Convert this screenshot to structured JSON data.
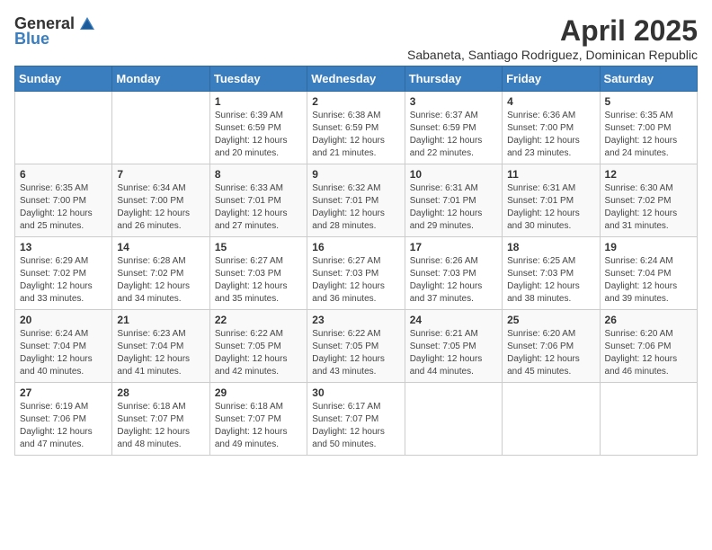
{
  "logo": {
    "general": "General",
    "blue": "Blue"
  },
  "title": "April 2025",
  "subtitle": "Sabaneta, Santiago Rodriguez, Dominican Republic",
  "days_header": [
    "Sunday",
    "Monday",
    "Tuesday",
    "Wednesday",
    "Thursday",
    "Friday",
    "Saturday"
  ],
  "weeks": [
    [
      {
        "day": null,
        "info": null
      },
      {
        "day": null,
        "info": null
      },
      {
        "day": "1",
        "sunrise": "Sunrise: 6:39 AM",
        "sunset": "Sunset: 6:59 PM",
        "daylight": "Daylight: 12 hours and 20 minutes."
      },
      {
        "day": "2",
        "sunrise": "Sunrise: 6:38 AM",
        "sunset": "Sunset: 6:59 PM",
        "daylight": "Daylight: 12 hours and 21 minutes."
      },
      {
        "day": "3",
        "sunrise": "Sunrise: 6:37 AM",
        "sunset": "Sunset: 6:59 PM",
        "daylight": "Daylight: 12 hours and 22 minutes."
      },
      {
        "day": "4",
        "sunrise": "Sunrise: 6:36 AM",
        "sunset": "Sunset: 7:00 PM",
        "daylight": "Daylight: 12 hours and 23 minutes."
      },
      {
        "day": "5",
        "sunrise": "Sunrise: 6:35 AM",
        "sunset": "Sunset: 7:00 PM",
        "daylight": "Daylight: 12 hours and 24 minutes."
      }
    ],
    [
      {
        "day": "6",
        "sunrise": "Sunrise: 6:35 AM",
        "sunset": "Sunset: 7:00 PM",
        "daylight": "Daylight: 12 hours and 25 minutes."
      },
      {
        "day": "7",
        "sunrise": "Sunrise: 6:34 AM",
        "sunset": "Sunset: 7:00 PM",
        "daylight": "Daylight: 12 hours and 26 minutes."
      },
      {
        "day": "8",
        "sunrise": "Sunrise: 6:33 AM",
        "sunset": "Sunset: 7:01 PM",
        "daylight": "Daylight: 12 hours and 27 minutes."
      },
      {
        "day": "9",
        "sunrise": "Sunrise: 6:32 AM",
        "sunset": "Sunset: 7:01 PM",
        "daylight": "Daylight: 12 hours and 28 minutes."
      },
      {
        "day": "10",
        "sunrise": "Sunrise: 6:31 AM",
        "sunset": "Sunset: 7:01 PM",
        "daylight": "Daylight: 12 hours and 29 minutes."
      },
      {
        "day": "11",
        "sunrise": "Sunrise: 6:31 AM",
        "sunset": "Sunset: 7:01 PM",
        "daylight": "Daylight: 12 hours and 30 minutes."
      },
      {
        "day": "12",
        "sunrise": "Sunrise: 6:30 AM",
        "sunset": "Sunset: 7:02 PM",
        "daylight": "Daylight: 12 hours and 31 minutes."
      }
    ],
    [
      {
        "day": "13",
        "sunrise": "Sunrise: 6:29 AM",
        "sunset": "Sunset: 7:02 PM",
        "daylight": "Daylight: 12 hours and 33 minutes."
      },
      {
        "day": "14",
        "sunrise": "Sunrise: 6:28 AM",
        "sunset": "Sunset: 7:02 PM",
        "daylight": "Daylight: 12 hours and 34 minutes."
      },
      {
        "day": "15",
        "sunrise": "Sunrise: 6:27 AM",
        "sunset": "Sunset: 7:03 PM",
        "daylight": "Daylight: 12 hours and 35 minutes."
      },
      {
        "day": "16",
        "sunrise": "Sunrise: 6:27 AM",
        "sunset": "Sunset: 7:03 PM",
        "daylight": "Daylight: 12 hours and 36 minutes."
      },
      {
        "day": "17",
        "sunrise": "Sunrise: 6:26 AM",
        "sunset": "Sunset: 7:03 PM",
        "daylight": "Daylight: 12 hours and 37 minutes."
      },
      {
        "day": "18",
        "sunrise": "Sunrise: 6:25 AM",
        "sunset": "Sunset: 7:03 PM",
        "daylight": "Daylight: 12 hours and 38 minutes."
      },
      {
        "day": "19",
        "sunrise": "Sunrise: 6:24 AM",
        "sunset": "Sunset: 7:04 PM",
        "daylight": "Daylight: 12 hours and 39 minutes."
      }
    ],
    [
      {
        "day": "20",
        "sunrise": "Sunrise: 6:24 AM",
        "sunset": "Sunset: 7:04 PM",
        "daylight": "Daylight: 12 hours and 40 minutes."
      },
      {
        "day": "21",
        "sunrise": "Sunrise: 6:23 AM",
        "sunset": "Sunset: 7:04 PM",
        "daylight": "Daylight: 12 hours and 41 minutes."
      },
      {
        "day": "22",
        "sunrise": "Sunrise: 6:22 AM",
        "sunset": "Sunset: 7:05 PM",
        "daylight": "Daylight: 12 hours and 42 minutes."
      },
      {
        "day": "23",
        "sunrise": "Sunrise: 6:22 AM",
        "sunset": "Sunset: 7:05 PM",
        "daylight": "Daylight: 12 hours and 43 minutes."
      },
      {
        "day": "24",
        "sunrise": "Sunrise: 6:21 AM",
        "sunset": "Sunset: 7:05 PM",
        "daylight": "Daylight: 12 hours and 44 minutes."
      },
      {
        "day": "25",
        "sunrise": "Sunrise: 6:20 AM",
        "sunset": "Sunset: 7:06 PM",
        "daylight": "Daylight: 12 hours and 45 minutes."
      },
      {
        "day": "26",
        "sunrise": "Sunrise: 6:20 AM",
        "sunset": "Sunset: 7:06 PM",
        "daylight": "Daylight: 12 hours and 46 minutes."
      }
    ],
    [
      {
        "day": "27",
        "sunrise": "Sunrise: 6:19 AM",
        "sunset": "Sunset: 7:06 PM",
        "daylight": "Daylight: 12 hours and 47 minutes."
      },
      {
        "day": "28",
        "sunrise": "Sunrise: 6:18 AM",
        "sunset": "Sunset: 7:07 PM",
        "daylight": "Daylight: 12 hours and 48 minutes."
      },
      {
        "day": "29",
        "sunrise": "Sunrise: 6:18 AM",
        "sunset": "Sunset: 7:07 PM",
        "daylight": "Daylight: 12 hours and 49 minutes."
      },
      {
        "day": "30",
        "sunrise": "Sunrise: 6:17 AM",
        "sunset": "Sunset: 7:07 PM",
        "daylight": "Daylight: 12 hours and 50 minutes."
      },
      {
        "day": null,
        "info": null
      },
      {
        "day": null,
        "info": null
      },
      {
        "day": null,
        "info": null
      }
    ]
  ]
}
